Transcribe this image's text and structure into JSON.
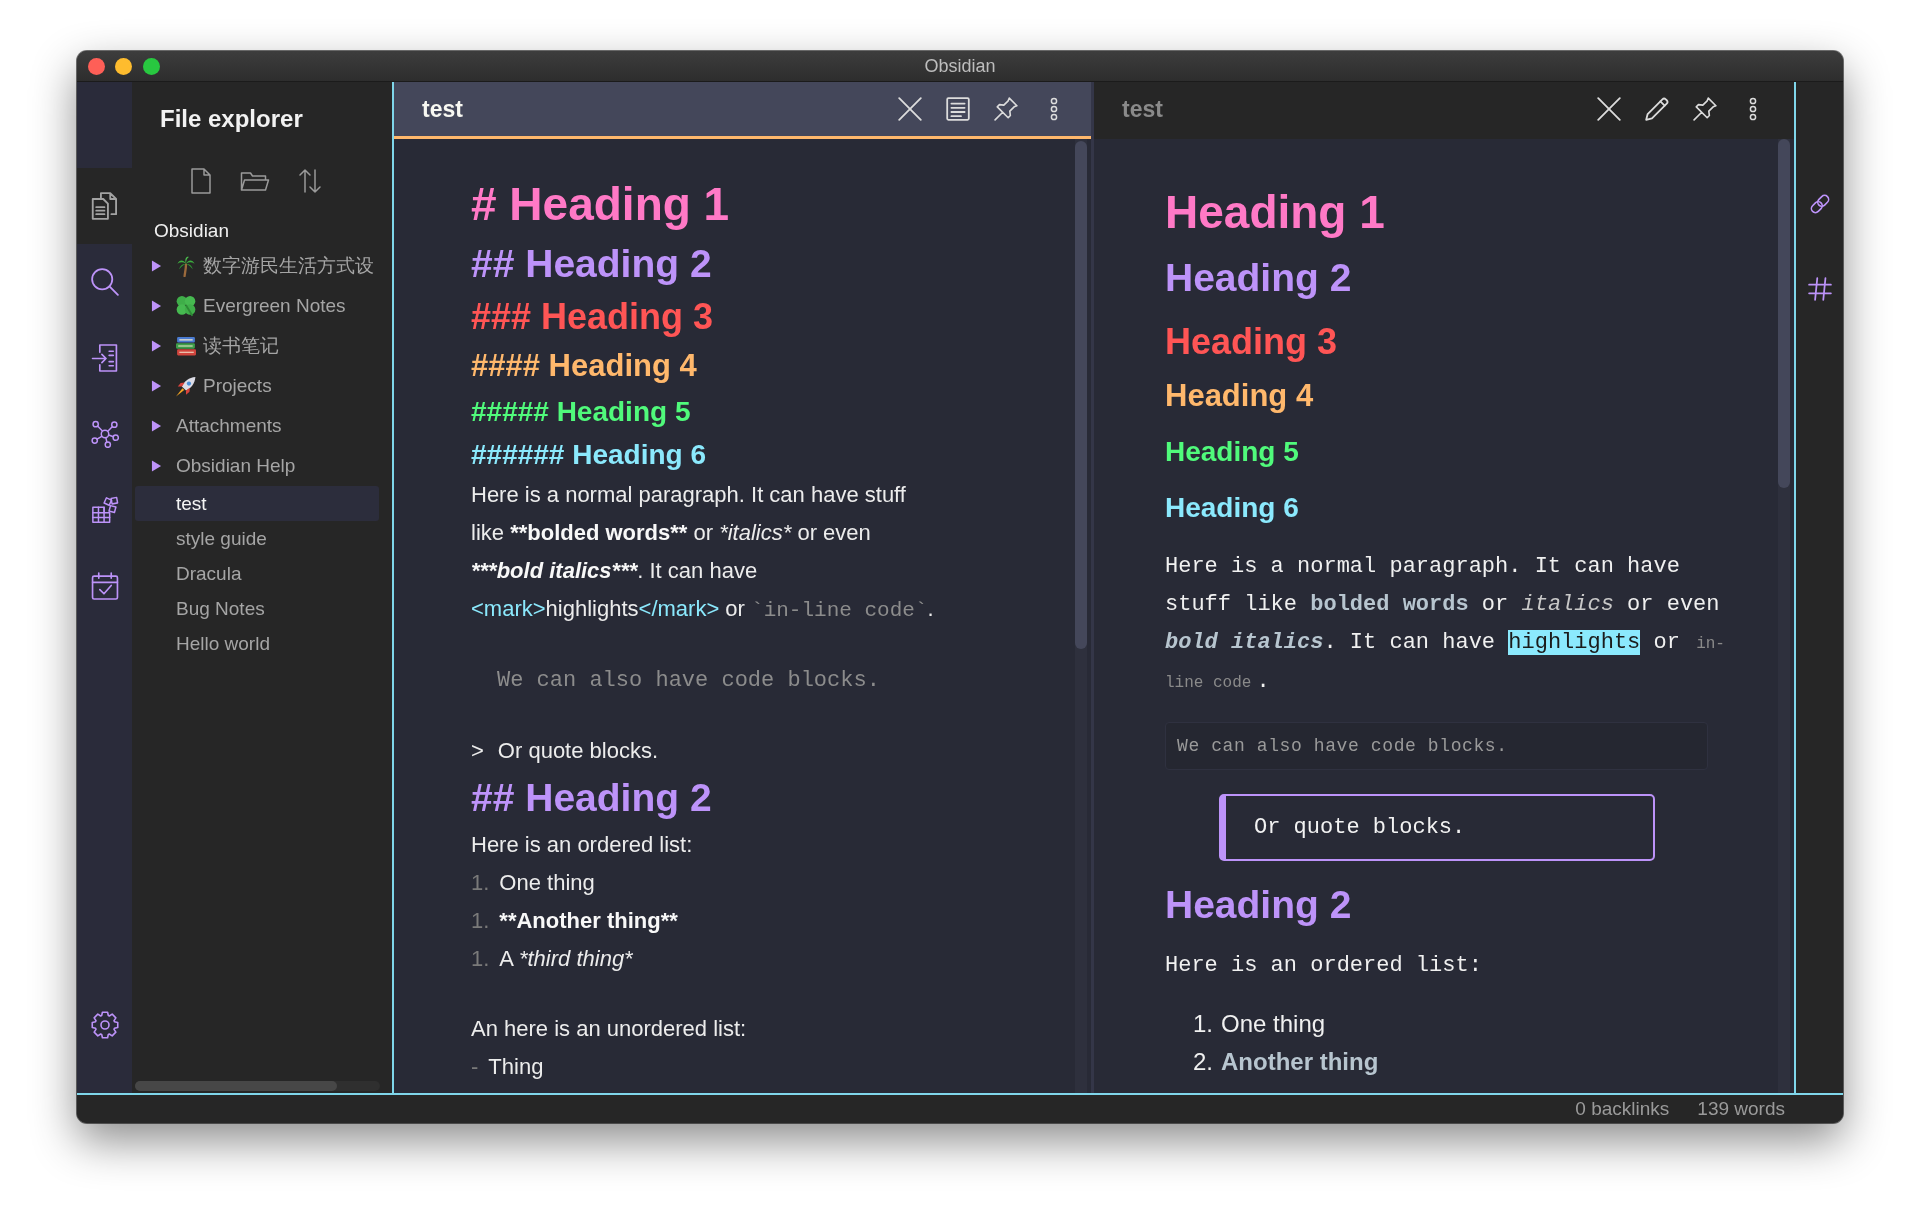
{
  "window": {
    "title": "Obsidian"
  },
  "ribbon": {
    "items": [
      {
        "kind": "files",
        "selected": true
      },
      {
        "kind": "search",
        "selected": false
      },
      {
        "kind": "import",
        "selected": false
      },
      {
        "kind": "graph",
        "selected": false
      },
      {
        "kind": "plugins",
        "selected": false
      },
      {
        "kind": "calendar",
        "selected": false
      }
    ]
  },
  "sidebar": {
    "title": "File explorer",
    "vault": "Obsidian",
    "folders": [
      {
        "kind": "palm",
        "name": "数字游民生活方式设",
        "expanded": false,
        "selected": false
      },
      {
        "kind": "clover",
        "name": "Evergreen Notes",
        "expanded": false,
        "selected": false
      },
      {
        "kind": "books",
        "name": "读书笔记",
        "expanded": false,
        "selected": false
      },
      {
        "kind": "rocket",
        "name": "Projects",
        "expanded": false,
        "selected": false
      },
      {
        "kind": "plain",
        "name": "Attachments",
        "expanded": false,
        "selected": false
      },
      {
        "kind": "plain",
        "name": "Obsidian Help",
        "expanded": false,
        "selected": false
      }
    ],
    "files": [
      {
        "name": "test",
        "selected": true
      },
      {
        "name": "style guide",
        "selected": false
      },
      {
        "name": "Dracula",
        "selected": false
      },
      {
        "name": "Bug Notes",
        "selected": false
      },
      {
        "name": "Hello world",
        "selected": false
      }
    ]
  },
  "panes": [
    {
      "kind": "source",
      "title": "test",
      "active": true,
      "lines": [
        {
          "kind": "h1",
          "text": "# Heading 1"
        },
        {
          "kind": "h2",
          "text": "## Heading 2"
        },
        {
          "kind": "h3",
          "text": "### Heading 3"
        },
        {
          "kind": "h4",
          "text": "#### Heading 4"
        },
        {
          "kind": "h5",
          "text": "##### Heading 5"
        },
        {
          "kind": "h6",
          "text": "###### Heading 6"
        },
        {
          "kind": "paragraph",
          "parts": [
            {
              "kind": "plain",
              "text": "Here is a normal paragraph. It can have stuff like "
            },
            {
              "kind": "bold",
              "text": "**bolded words**"
            },
            {
              "kind": "plain",
              "text": " or "
            },
            {
              "kind": "italic",
              "text": "*italics*"
            },
            {
              "kind": "plain",
              "text": " or even "
            },
            {
              "kind": "bolditalic",
              "text": "***bold italics***"
            },
            {
              "kind": "plain",
              "text": ". It can have "
            },
            {
              "kind": "tag",
              "text": "<mark>"
            },
            {
              "kind": "plain",
              "text": "highlights"
            },
            {
              "kind": "tag",
              "text": "</mark>"
            },
            {
              "kind": "plain",
              "text": " or "
            },
            {
              "kind": "code",
              "text": "`in-line code`"
            },
            {
              "kind": "plain",
              "text": "."
            }
          ]
        },
        {
          "kind": "blank"
        },
        {
          "kind": "code",
          "text": "We can also have code blocks."
        },
        {
          "kind": "blank"
        },
        {
          "kind": "quote",
          "marker": ">",
          "text": "Or quote blocks."
        },
        {
          "kind": "h2",
          "text": "## Heading 2"
        },
        {
          "kind": "paragraph",
          "parts": [
            {
              "kind": "plain",
              "text": "Here is an ordered list:"
            }
          ]
        },
        {
          "kind": "item",
          "marker": "1.",
          "parts": [
            {
              "kind": "plain",
              "text": "One thing"
            }
          ]
        },
        {
          "kind": "item",
          "marker": "1.",
          "parts": [
            {
              "kind": "bold",
              "text": "**Another thing**"
            }
          ]
        },
        {
          "kind": "item",
          "marker": "1.",
          "parts": [
            {
              "kind": "plain",
              "text": "A "
            },
            {
              "kind": "italic",
              "text": "*third thing*"
            }
          ]
        },
        {
          "kind": "blank"
        },
        {
          "kind": "paragraph",
          "parts": [
            {
              "kind": "plain",
              "text": "An here is an unordered list:"
            }
          ]
        },
        {
          "kind": "item",
          "marker": "-",
          "parts": [
            {
              "kind": "plain",
              "text": "Thing"
            }
          ]
        }
      ]
    },
    {
      "kind": "preview",
      "title": "test",
      "active": false,
      "blocks": [
        {
          "kind": "h1",
          "text": "Heading 1"
        },
        {
          "kind": "h2",
          "text": "Heading 2"
        },
        {
          "kind": "h3",
          "text": "Heading 3"
        },
        {
          "kind": "h4",
          "text": "Heading 4"
        },
        {
          "kind": "h5",
          "text": "Heading 5"
        },
        {
          "kind": "h6",
          "text": "Heading 6"
        },
        {
          "kind": "paragraph",
          "parts": [
            {
              "kind": "plain",
              "text": "Here is a normal paragraph. It can have stuff like "
            },
            {
              "kind": "bold",
              "text": "bolded words"
            },
            {
              "kind": "plain",
              "text": " or "
            },
            {
              "kind": "italic",
              "text": "italics"
            },
            {
              "kind": "plain",
              "text": " or even "
            },
            {
              "kind": "bolditalic",
              "text": "bold italics"
            },
            {
              "kind": "plain",
              "text": ". It can have "
            },
            {
              "kind": "highlight",
              "text": "highlights"
            },
            {
              "kind": "plain",
              "text": " or "
            },
            {
              "kind": "code",
              "text": "in-line code"
            },
            {
              "kind": "plain",
              "text": "."
            }
          ]
        },
        {
          "kind": "code",
          "text": "We can also have code blocks."
        },
        {
          "kind": "quote",
          "text": "Or quote blocks."
        },
        {
          "kind": "h2",
          "text": "Heading 2"
        },
        {
          "kind": "paragraph",
          "parts": [
            {
              "kind": "plain",
              "text": "Here is an ordered list:"
            }
          ]
        },
        {
          "kind": "item",
          "marker": "1.",
          "parts": [
            {
              "kind": "plain",
              "text": "One thing"
            }
          ]
        },
        {
          "kind": "item",
          "marker": "2.",
          "parts": [
            {
              "kind": "bold",
              "text": "Another thing"
            }
          ]
        }
      ]
    }
  ],
  "status_bar": {
    "backlinks": "0 backlinks",
    "words": "139 words"
  }
}
